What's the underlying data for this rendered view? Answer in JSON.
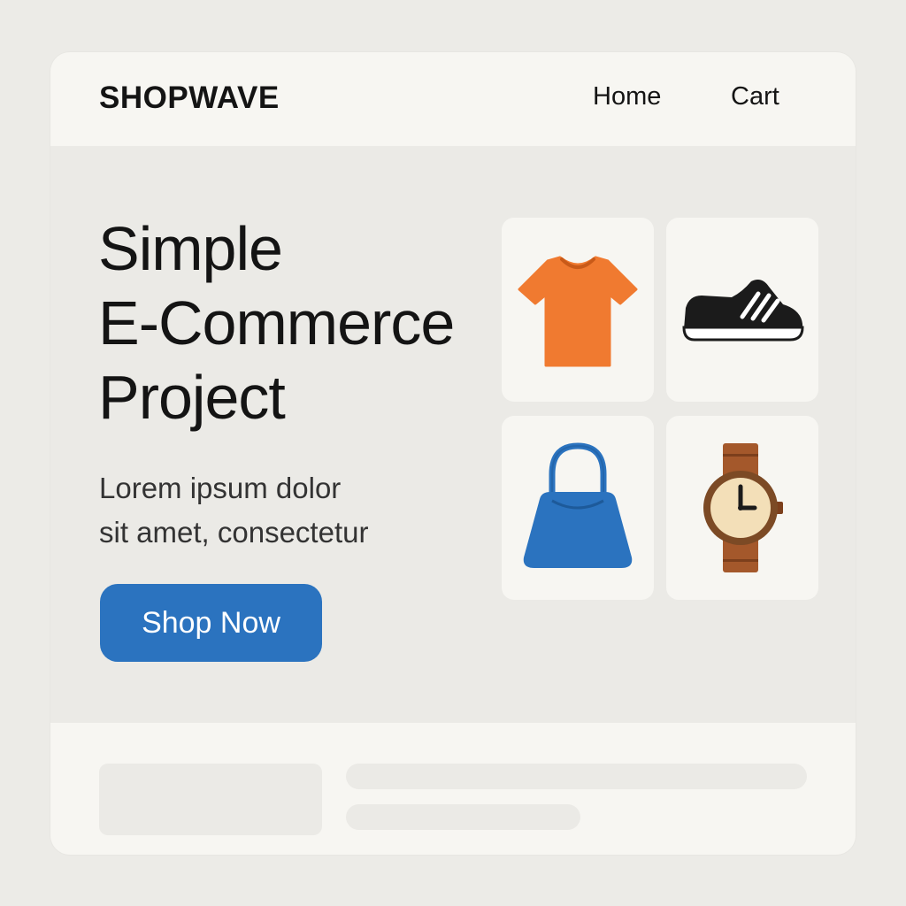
{
  "header": {
    "logo": "SHOPWAVE",
    "nav": [
      {
        "label": "Home"
      },
      {
        "label": "Cart"
      }
    ]
  },
  "hero": {
    "title_lines": [
      "Simple",
      "E-Commerce",
      "Project"
    ],
    "text_lines": [
      "Lorem ipsum dolor",
      "sit amet, consectetur"
    ],
    "cta_label": "Shop Now"
  },
  "products": [
    {
      "icon": "t-shirt-icon",
      "color": "#f07a30"
    },
    {
      "icon": "sneaker-icon",
      "color": "#1b1b1b"
    },
    {
      "icon": "handbag-icon",
      "color": "#2b73bf"
    },
    {
      "icon": "wristwatch-icon",
      "color": "#a4582b"
    }
  ],
  "colors": {
    "background": "#ecebe7",
    "panel": "#f7f6f2",
    "accent": "#2b73bf",
    "text": "#141414"
  }
}
